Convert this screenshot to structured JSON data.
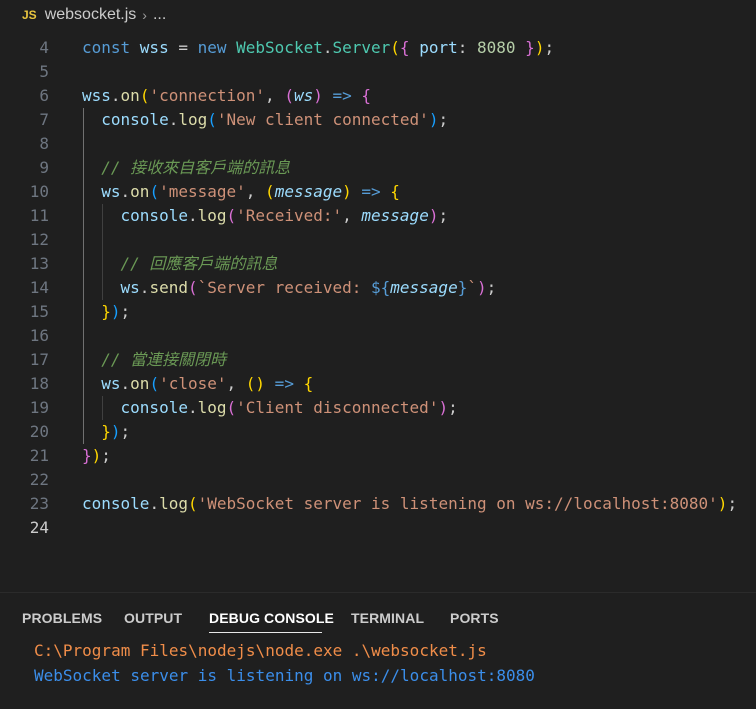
{
  "breadcrumb": {
    "icon": "JS",
    "file": "websocket.js",
    "separator": "›",
    "more": "..."
  },
  "editor": {
    "lines": [
      {
        "num": "4",
        "tokens": [
          {
            "t": "const ",
            "c": "kw"
          },
          {
            "t": "wss",
            "c": "var"
          },
          {
            "t": " = ",
            "c": ""
          },
          {
            "t": "new ",
            "c": "kw"
          },
          {
            "t": "WebSocket",
            "c": "cls"
          },
          {
            "t": ".",
            "c": ""
          },
          {
            "t": "Server",
            "c": "cls"
          },
          {
            "t": "(",
            "c": "b1"
          },
          {
            "t": "{",
            "c": "b2"
          },
          {
            "t": " port",
            "c": "var"
          },
          {
            "t": ": ",
            "c": ""
          },
          {
            "t": "8080",
            "c": "num"
          },
          {
            "t": " ",
            "c": ""
          },
          {
            "t": "}",
            "c": "b2"
          },
          {
            "t": ")",
            "c": "b1"
          },
          {
            "t": ";",
            "c": ""
          }
        ]
      },
      {
        "num": "5",
        "tokens": []
      },
      {
        "num": "6",
        "tokens": [
          {
            "t": "wss",
            "c": "var"
          },
          {
            "t": ".",
            "c": ""
          },
          {
            "t": "on",
            "c": "fn"
          },
          {
            "t": "(",
            "c": "b1"
          },
          {
            "t": "'connection'",
            "c": "str"
          },
          {
            "t": ", ",
            "c": ""
          },
          {
            "t": "(",
            "c": "b2"
          },
          {
            "t": "ws",
            "c": "var it"
          },
          {
            "t": ")",
            "c": "b2"
          },
          {
            "t": " => ",
            "c": "kw"
          },
          {
            "t": "{",
            "c": "b2"
          }
        ]
      },
      {
        "num": "7",
        "tokens": [
          {
            "t": "  console",
            "c": "var"
          },
          {
            "t": ".",
            "c": ""
          },
          {
            "t": "log",
            "c": "fn"
          },
          {
            "t": "(",
            "c": "b3"
          },
          {
            "t": "'New client connected'",
            "c": "str"
          },
          {
            "t": ")",
            "c": "b3"
          },
          {
            "t": ";",
            "c": ""
          }
        ]
      },
      {
        "num": "8",
        "tokens": []
      },
      {
        "num": "9",
        "tokens": [
          {
            "t": "  // 接收來自客戶端的訊息",
            "c": "cmt"
          }
        ]
      },
      {
        "num": "10",
        "tokens": [
          {
            "t": "  ws",
            "c": "var"
          },
          {
            "t": ".",
            "c": ""
          },
          {
            "t": "on",
            "c": "fn"
          },
          {
            "t": "(",
            "c": "b3"
          },
          {
            "t": "'message'",
            "c": "str"
          },
          {
            "t": ", ",
            "c": ""
          },
          {
            "t": "(",
            "c": "b1"
          },
          {
            "t": "message",
            "c": "var it"
          },
          {
            "t": ")",
            "c": "b1"
          },
          {
            "t": " => ",
            "c": "kw"
          },
          {
            "t": "{",
            "c": "b1"
          }
        ]
      },
      {
        "num": "11",
        "tokens": [
          {
            "t": "    console",
            "c": "var"
          },
          {
            "t": ".",
            "c": ""
          },
          {
            "t": "log",
            "c": "fn"
          },
          {
            "t": "(",
            "c": "b2"
          },
          {
            "t": "'Received:'",
            "c": "str"
          },
          {
            "t": ", ",
            "c": ""
          },
          {
            "t": "message",
            "c": "var it"
          },
          {
            "t": ")",
            "c": "b2"
          },
          {
            "t": ";",
            "c": ""
          }
        ]
      },
      {
        "num": "12",
        "tokens": []
      },
      {
        "num": "13",
        "tokens": [
          {
            "t": "    // 回應客戶端的訊息",
            "c": "cmt"
          }
        ]
      },
      {
        "num": "14",
        "tokens": [
          {
            "t": "    ws",
            "c": "var"
          },
          {
            "t": ".",
            "c": ""
          },
          {
            "t": "send",
            "c": "fn"
          },
          {
            "t": "(",
            "c": "b2"
          },
          {
            "t": "`Server received: ",
            "c": "str"
          },
          {
            "t": "${",
            "c": "tpl"
          },
          {
            "t": "message",
            "c": "var it"
          },
          {
            "t": "}",
            "c": "tpl"
          },
          {
            "t": "`",
            "c": "str"
          },
          {
            "t": ")",
            "c": "b2"
          },
          {
            "t": ";",
            "c": ""
          }
        ]
      },
      {
        "num": "15",
        "tokens": [
          {
            "t": "  ",
            "c": ""
          },
          {
            "t": "}",
            "c": "b1"
          },
          {
            "t": ")",
            "c": "b3"
          },
          {
            "t": ";",
            "c": ""
          }
        ]
      },
      {
        "num": "16",
        "tokens": []
      },
      {
        "num": "17",
        "tokens": [
          {
            "t": "  // 當連接關閉時",
            "c": "cmt"
          }
        ]
      },
      {
        "num": "18",
        "tokens": [
          {
            "t": "  ws",
            "c": "var"
          },
          {
            "t": ".",
            "c": ""
          },
          {
            "t": "on",
            "c": "fn"
          },
          {
            "t": "(",
            "c": "b3"
          },
          {
            "t": "'close'",
            "c": "str"
          },
          {
            "t": ", ",
            "c": ""
          },
          {
            "t": "()",
            "c": "b1"
          },
          {
            "t": " => ",
            "c": "kw"
          },
          {
            "t": "{",
            "c": "b1"
          }
        ]
      },
      {
        "num": "19",
        "tokens": [
          {
            "t": "    console",
            "c": "var"
          },
          {
            "t": ".",
            "c": ""
          },
          {
            "t": "log",
            "c": "fn"
          },
          {
            "t": "(",
            "c": "b2"
          },
          {
            "t": "'Client disconnected'",
            "c": "str"
          },
          {
            "t": ")",
            "c": "b2"
          },
          {
            "t": ";",
            "c": ""
          }
        ]
      },
      {
        "num": "20",
        "tokens": [
          {
            "t": "  ",
            "c": ""
          },
          {
            "t": "}",
            "c": "b1"
          },
          {
            "t": ")",
            "c": "b3"
          },
          {
            "t": ";",
            "c": ""
          }
        ]
      },
      {
        "num": "21",
        "tokens": [
          {
            "t": "}",
            "c": "b2"
          },
          {
            "t": ")",
            "c": "b1"
          },
          {
            "t": ";",
            "c": ""
          }
        ]
      },
      {
        "num": "22",
        "tokens": []
      },
      {
        "num": "23",
        "tokens": [
          {
            "t": "console",
            "c": "var"
          },
          {
            "t": ".",
            "c": ""
          },
          {
            "t": "log",
            "c": "fn"
          },
          {
            "t": "(",
            "c": "b1"
          },
          {
            "t": "'WebSocket server is listening on ws://localhost:8080'",
            "c": "str"
          },
          {
            "t": ")",
            "c": "b1"
          },
          {
            "t": ";",
            "c": ""
          }
        ]
      },
      {
        "num": "24",
        "tokens": [],
        "active": true
      }
    ]
  },
  "panel": {
    "tabs": [
      {
        "label": "PROBLEMS",
        "active": false
      },
      {
        "label": "OUTPUT",
        "active": false
      },
      {
        "label": "DEBUG CONSOLE",
        "active": true
      },
      {
        "label": "TERMINAL",
        "active": false
      },
      {
        "label": "PORTS",
        "active": false
      }
    ],
    "console": [
      {
        "text": "C:\\Program Files\\nodejs\\node.exe .\\websocket.js",
        "kind": "cmd"
      },
      {
        "text": "WebSocket server is listening on ws://localhost:8080",
        "kind": "out"
      }
    ]
  },
  "colors": {
    "background": "#1f1f1f",
    "keyword": "#569cd6",
    "string": "#ce9178",
    "comment": "#6a9955",
    "function": "#dcdcaa",
    "class": "#4ec9b0",
    "console_cmd": "#f08d49",
    "console_out": "#3b8eea"
  }
}
